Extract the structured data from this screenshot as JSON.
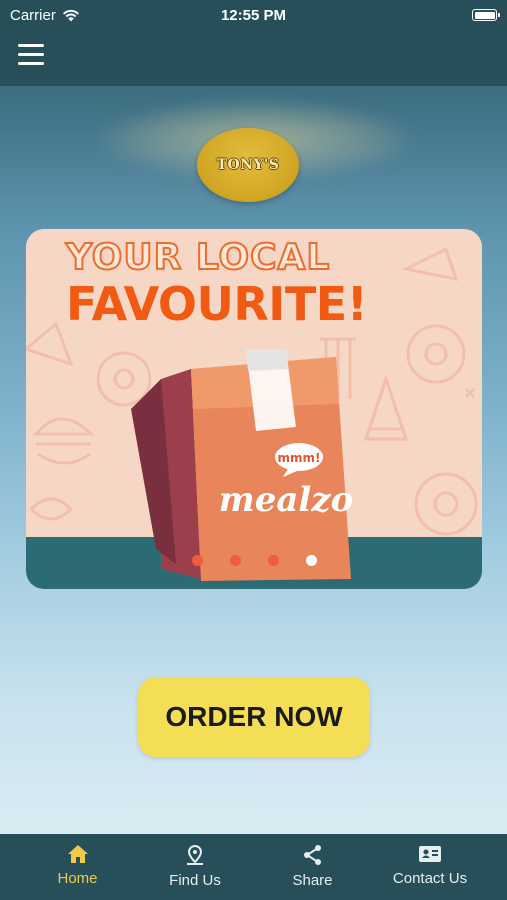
{
  "status_bar": {
    "carrier": "Carrier",
    "time": "12:55 PM"
  },
  "header": {
    "menu_icon": "hamburger-menu-icon"
  },
  "logo": {
    "text": "TONY'S"
  },
  "banner": {
    "headline_top": "YOUR LOCAL",
    "headline_bottom": "FAVOURITE!",
    "bag_speech": "mmm!",
    "bag_brand": "mealzo",
    "carousel": {
      "count": 4,
      "active_index": 3
    }
  },
  "cta": {
    "label": "ORDER NOW"
  },
  "tabs": [
    {
      "label": "Home",
      "icon": "home-icon",
      "active": true
    },
    {
      "label": "Find Us",
      "icon": "location-pin-icon",
      "active": false
    },
    {
      "label": "Share",
      "icon": "share-icon",
      "active": false
    },
    {
      "label": "Contact Us",
      "icon": "contact-card-icon",
      "active": false
    }
  ],
  "colors": {
    "bar": "#264f59",
    "accent": "#f2c84b",
    "cta": "#f3de55",
    "headline": "#f05a12"
  }
}
